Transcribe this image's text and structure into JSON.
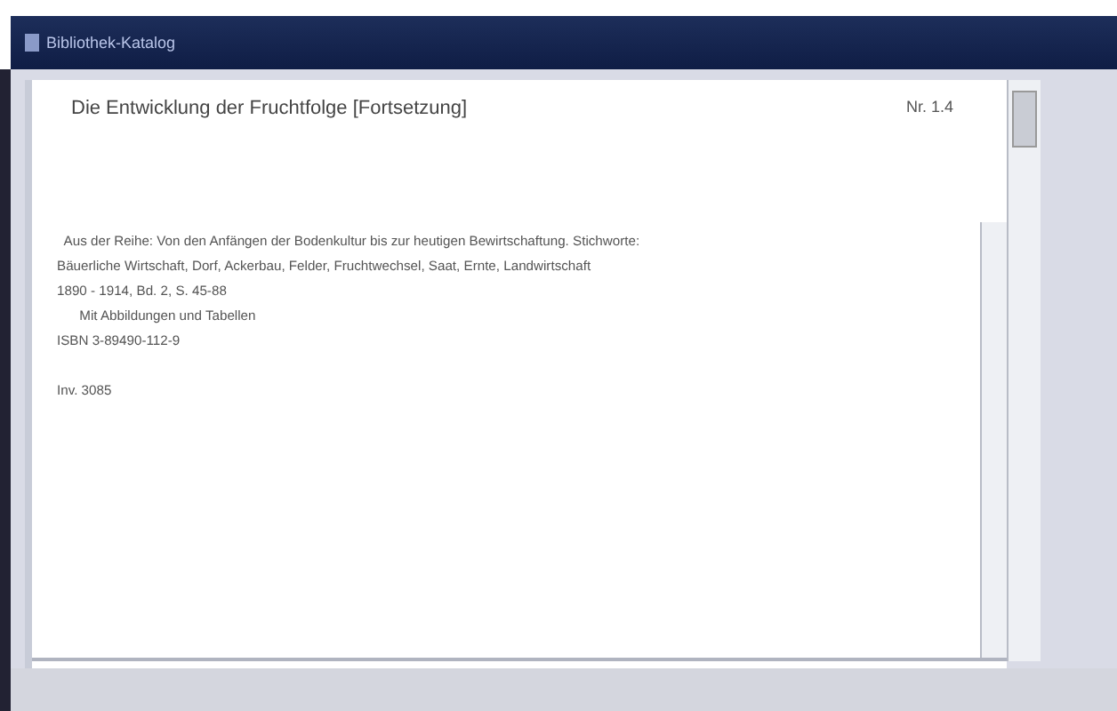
{
  "window": {
    "title": "Bibliothek-Katalog"
  },
  "record": {
    "title": "Die Entwicklung der Fruchtfolge [Fortsetzung]",
    "number": "Nr. 1.4"
  },
  "details": [
    "  Aus der Reihe: Von den Anfängen der Bodenkultur bis zur heutigen Bewirtschaftung. Stichworte:",
    "Bäuerliche Wirtschaft, Dorf, Ackerbau, Felder, Fruchtwechsel, Saat, Ernte, Landwirtschaft",
    "1890 - 1914, Bd. 2, S. 45-88",
    "      Mit Abbildungen und Tabellen",
    "ISBN 3-89490-112-9"
  ],
  "inventory": "Inv. 3085"
}
